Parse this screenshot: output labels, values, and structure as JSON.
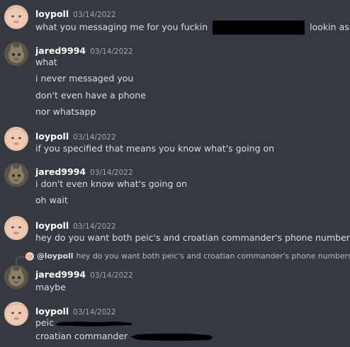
{
  "messages": [
    {
      "username": "loypoll",
      "timestamp": "03/14/2022",
      "lines": [
        {
          "before": "what you messaging me for you fuckin",
          "after": "lookin ass"
        }
      ]
    },
    {
      "username": "jared9994",
      "timestamp": "03/14/2022",
      "lines": [
        "what",
        "i never messaged you",
        "don't even have a phone",
        "nor whatsapp"
      ]
    },
    {
      "username": "loypoll",
      "timestamp": "03/14/2022",
      "lines": [
        "if you specified that means you know what's going on"
      ]
    },
    {
      "username": "jared9994",
      "timestamp": "03/14/2022",
      "lines": [
        "i don't even know what's going on",
        "oh wait"
      ]
    },
    {
      "username": "loypoll",
      "timestamp": "03/14/2022",
      "lines": [
        "hey do you want both peic's and croatian commander's phone numbers"
      ]
    },
    {
      "username": "jared9994",
      "timestamp": "03/14/2022",
      "reply": {
        "name": "@loypoll",
        "text": "hey do you want both peic's and croatian commander's phone numbers"
      },
      "lines": [
        "maybe"
      ]
    },
    {
      "username": "loypoll",
      "timestamp": "03/14/2022",
      "lines": [
        "peic",
        "croatian commander"
      ]
    }
  ],
  "colors": {
    "background": "#36393f",
    "username": "#ffffff",
    "text": "#dcddde",
    "timestamp": "#a3a6aa"
  },
  "icons": {
    "loypoll_avatar": "face-avatar-icon",
    "jared_avatar": "cat-avatar-icon",
    "reply": "reply-spine-icon"
  }
}
